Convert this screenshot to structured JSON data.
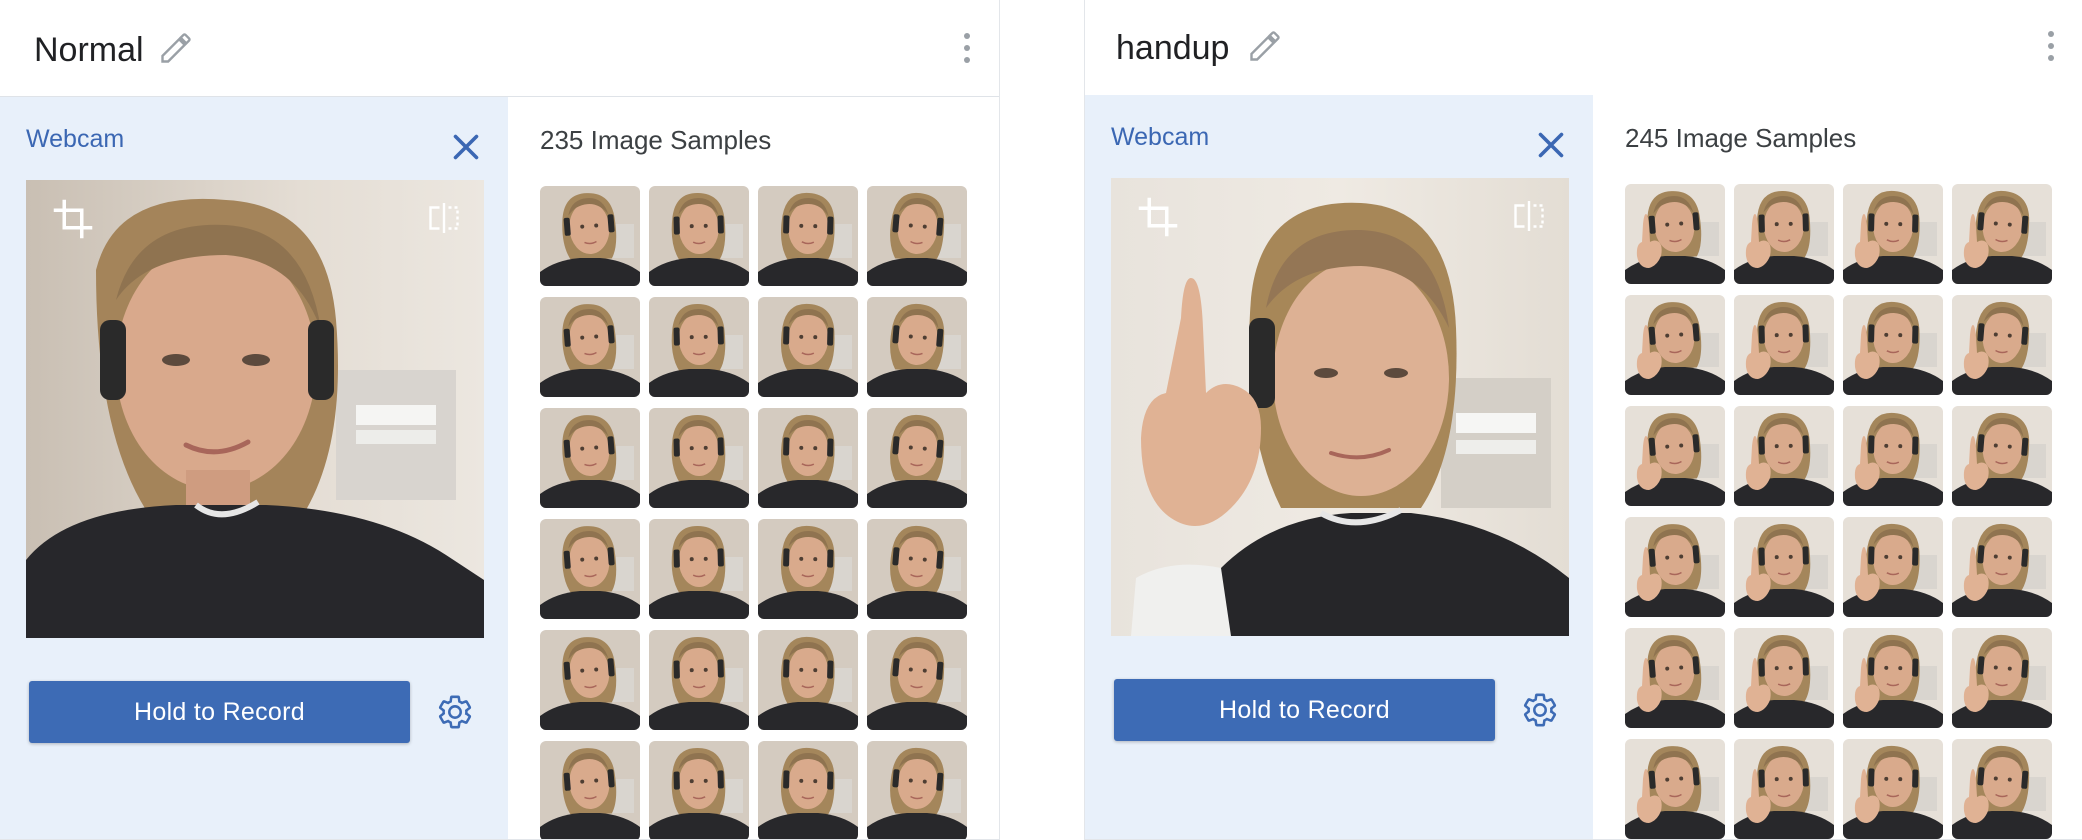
{
  "colors": {
    "accent": "#3d6bb5",
    "webcam_label": "#3b67b3",
    "panel_bg": "#e8f0fa",
    "icon_gray": "#9aa0a6"
  },
  "classes": [
    {
      "title": "Normal",
      "webcam_label": "Webcam",
      "samples_label": "235 Image Samples",
      "record_label": "Hold to Record",
      "pose": "normal",
      "thumbs": 24,
      "icons": [
        "edit-icon",
        "more-vert-icon",
        "close-icon",
        "crop-icon",
        "flip-icon",
        "gear-icon"
      ]
    },
    {
      "title": "handup",
      "webcam_label": "Webcam",
      "samples_label": "245 Image Samples",
      "record_label": "Hold to Record",
      "pose": "handup",
      "thumbs": 24,
      "icons": [
        "edit-icon",
        "more-vert-icon",
        "close-icon",
        "crop-icon",
        "flip-icon",
        "gear-icon"
      ]
    }
  ]
}
